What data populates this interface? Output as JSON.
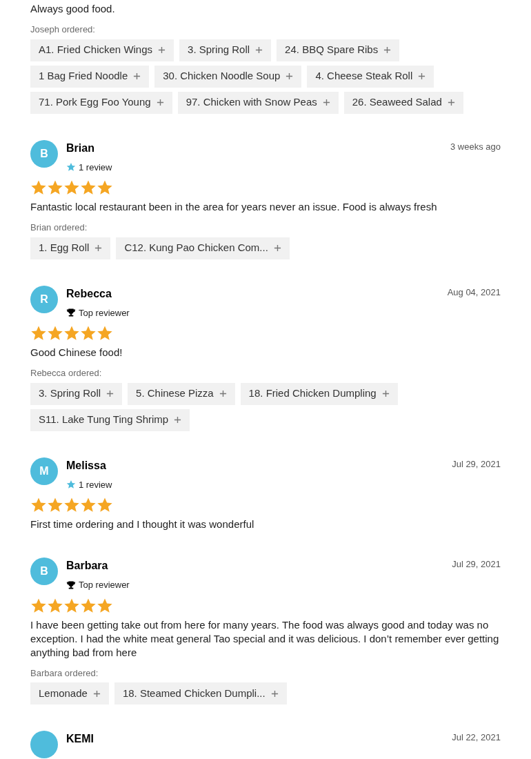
{
  "top_review": {
    "text": "Always good food.",
    "ordered_label": "Joseph ordered:",
    "items": [
      "A1. Fried Chicken Wings",
      "3. Spring Roll",
      "24. BBQ Spare Ribs",
      "1 Bag Fried Noodle",
      "30. Chicken Noodle Soup",
      "4. Cheese Steak Roll",
      "71. Pork Egg Foo Young",
      "97. Chicken with Snow Peas",
      "26. Seaweed Salad"
    ]
  },
  "reviews": [
    {
      "initial": "B",
      "name": "Brian",
      "kind": "count",
      "badge": "1 review",
      "date": "3 weeks ago",
      "stars": 5,
      "text": "Fantastic local restaurant been in the area for years never an issue. Food is always fresh",
      "ordered_label": "Brian ordered:",
      "items": [
        "1. Egg Roll",
        "C12. Kung Pao Chicken Com..."
      ]
    },
    {
      "initial": "R",
      "name": "Rebecca",
      "kind": "top",
      "badge": "Top reviewer",
      "date": "Aug 04, 2021",
      "stars": 5,
      "text": "Good Chinese food!",
      "ordered_label": "Rebecca ordered:",
      "items": [
        "3. Spring Roll",
        "5. Chinese Pizza",
        "18. Fried Chicken Dumpling",
        "S11. Lake Tung Ting Shrimp"
      ]
    },
    {
      "initial": "M",
      "name": "Melissa",
      "kind": "count",
      "badge": "1 review",
      "date": "Jul 29, 2021",
      "stars": 5,
      "text": "First time ordering and I thought it was wonderful"
    },
    {
      "initial": "B",
      "name": "Barbara",
      "kind": "top",
      "badge": "Top reviewer",
      "date": "Jul 29, 2021",
      "stars": 5,
      "text": "I have been getting take out from here for many years. The food was always good and today was no exception. I had the white meat general Tao special and it was delicious. I don’t remember ever getting anything bad from here",
      "ordered_label": "Barbara ordered:",
      "items": [
        "Lemonade",
        "18. Steamed Chicken Dumpli..."
      ]
    },
    {
      "name": "KEMI",
      "date": "Jul 22, 2021"
    }
  ]
}
